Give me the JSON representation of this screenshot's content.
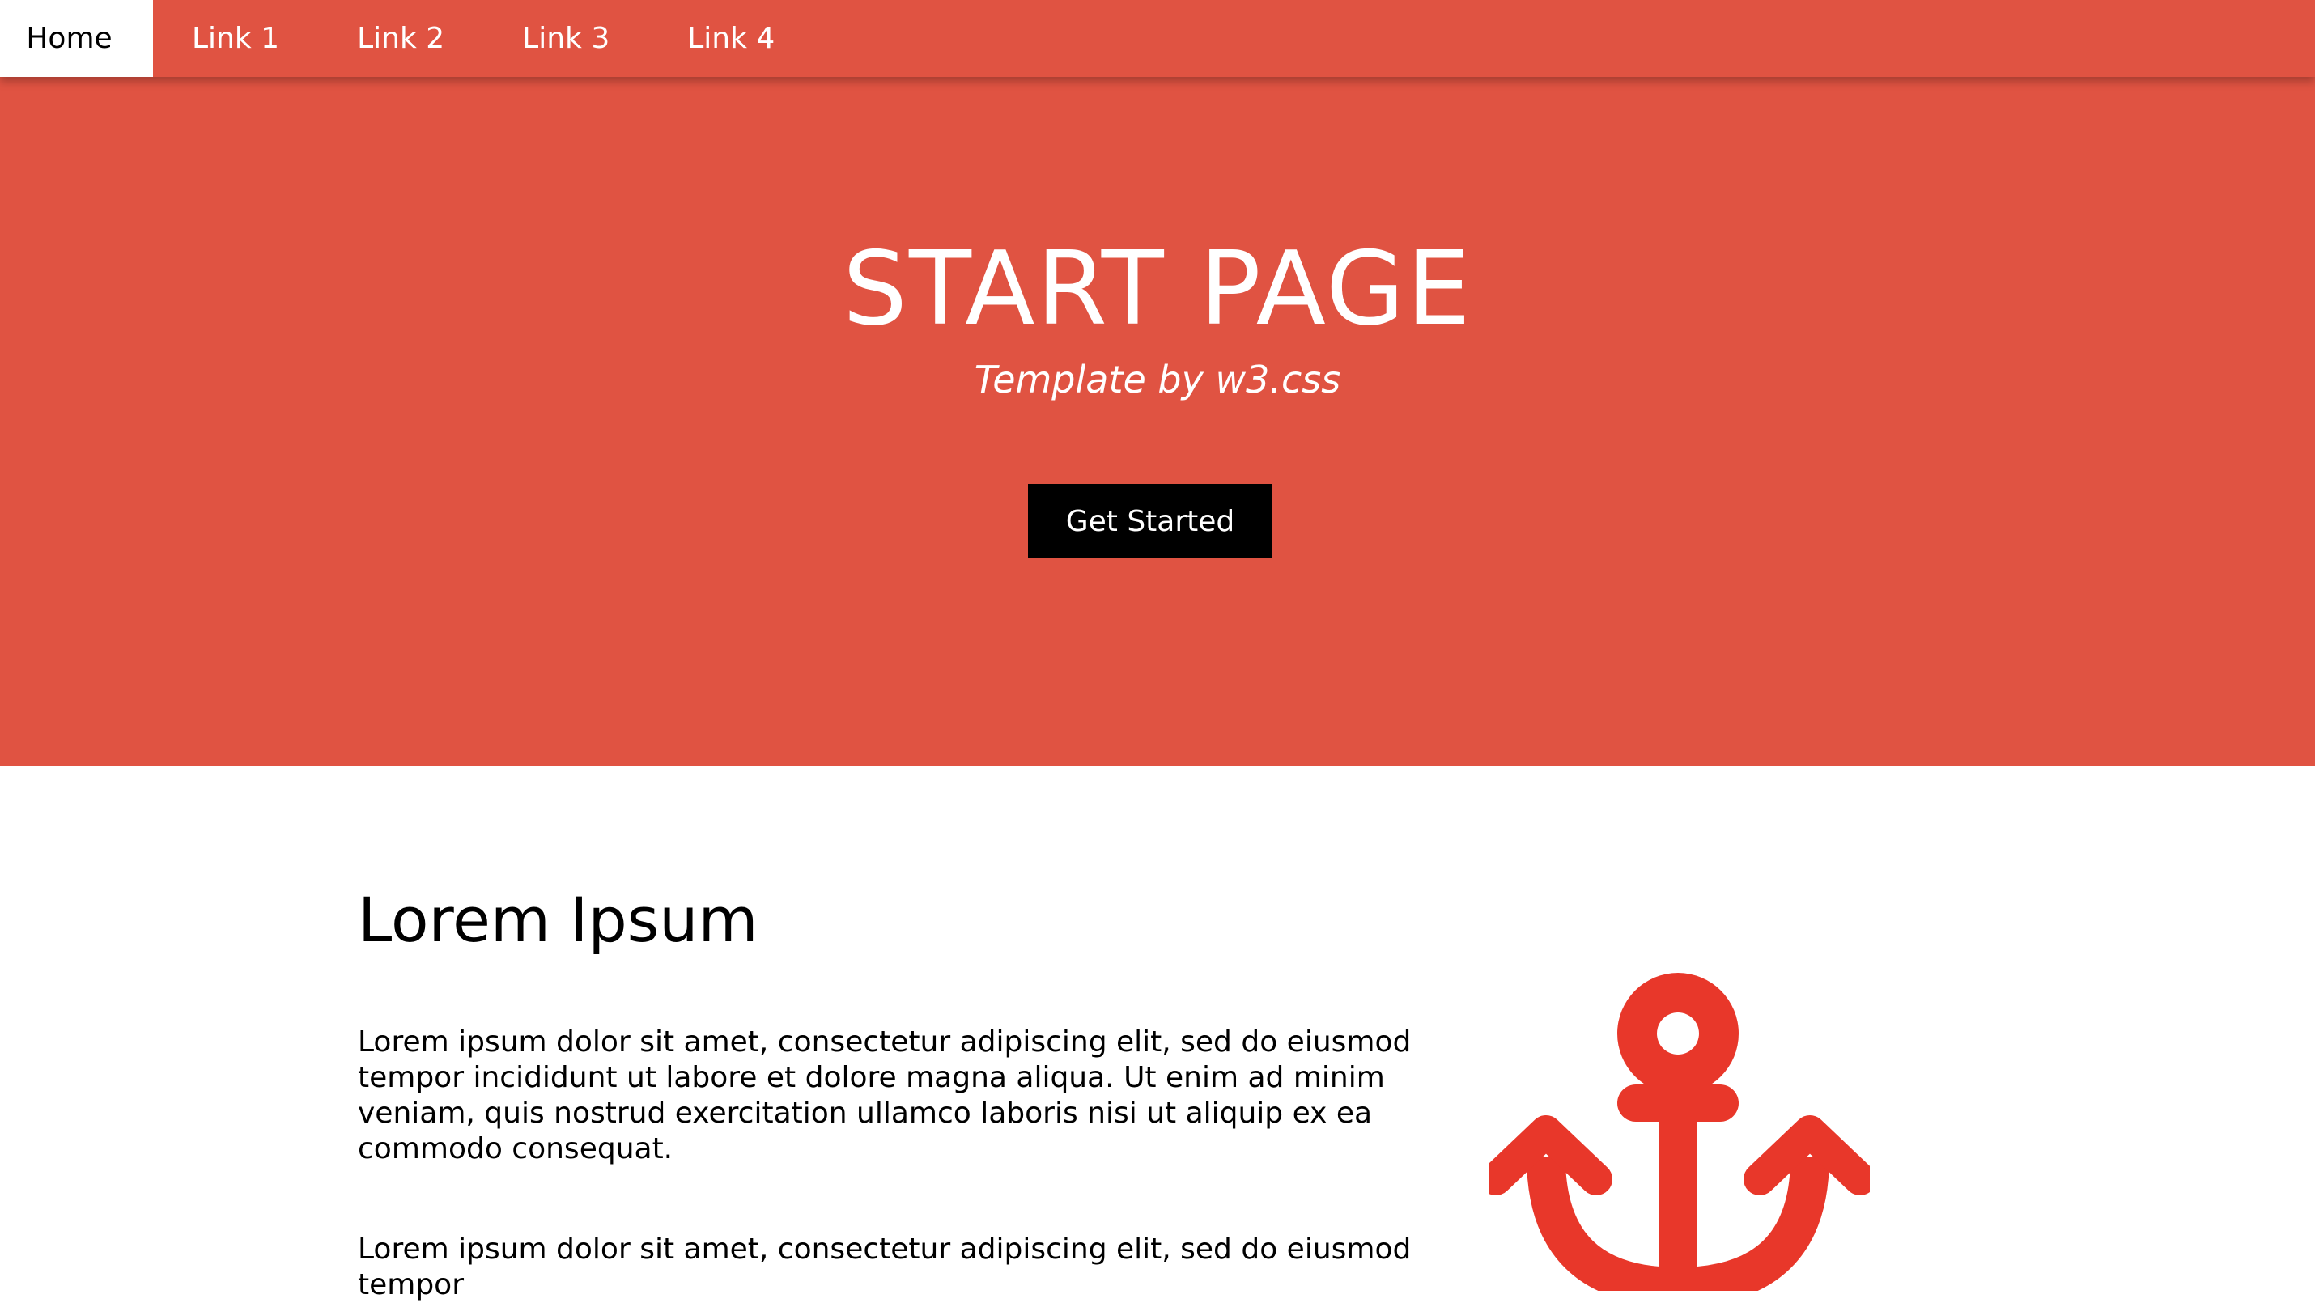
{
  "navbar": {
    "items": [
      {
        "label": "Home",
        "active": true
      },
      {
        "label": "Link 1",
        "active": false
      },
      {
        "label": "Link 2",
        "active": false
      },
      {
        "label": "Link 3",
        "active": false
      },
      {
        "label": "Link 4",
        "active": false
      }
    ]
  },
  "hero": {
    "title": "START PAGE",
    "subtitle": "Template by w3.css",
    "button_label": "Get Started"
  },
  "content": {
    "heading": "Lorem Ipsum",
    "paragraphs": [
      "Lorem ipsum dolor sit amet, consectetur adipiscing elit, sed do eiusmod tempor incididunt ut labore et dolore magna aliqua. Ut enim ad minim veniam, quis nostrud exercitation ullamco laboris nisi ut aliquip ex ea commodo consequat.",
      "Lorem ipsum dolor sit amet, consectetur adipiscing elit, sed do eiusmod tempor"
    ],
    "icon": "anchor-icon"
  },
  "colors": {
    "brand_red": "#e05342",
    "anchor_red": "#e8372a",
    "button_bg": "#000000"
  }
}
